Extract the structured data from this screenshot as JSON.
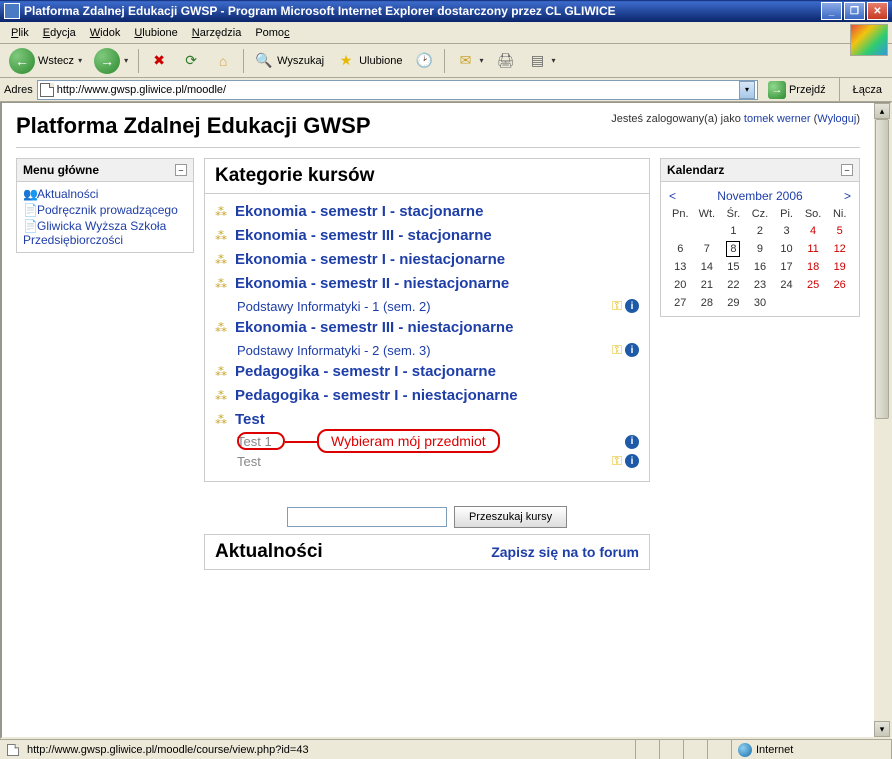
{
  "window": {
    "title": "Platforma Zdalnej Edukacji GWSP - Program Microsoft Internet Explorer dostarczony przez CL GLIWICE"
  },
  "menubar": {
    "file": "Plik",
    "edit": "Edycja",
    "view": "Widok",
    "favorites": "Ulubione",
    "tools": "Narzędzia",
    "help": "Pomoc"
  },
  "toolbar": {
    "back": "Wstecz",
    "search": "Wyszukaj",
    "favorites": "Ulubione"
  },
  "address": {
    "label": "Adres",
    "value": "http://www.gwsp.gliwice.pl/moodle/",
    "go": "Przejdź",
    "links": "Łącza"
  },
  "page": {
    "title": "Platforma Zdalnej Edukacji GWSP",
    "login_prefix": "Jesteś zalogowany(a) jako ",
    "user": "tomek werner",
    "logout": "Wyloguj"
  },
  "menu_block": {
    "title": "Menu główne",
    "items": [
      "Aktualności",
      "Podręcznik prowadzącego",
      "Gliwicka Wyższa Szkoła Przedsiębiorczości"
    ]
  },
  "categories": {
    "title": "Kategorie kursów",
    "list": [
      {
        "type": "cat",
        "label": "Ekonomia - semestr I - stacjonarne"
      },
      {
        "type": "cat",
        "label": "Ekonomia - semestr III - stacjonarne"
      },
      {
        "type": "cat",
        "label": "Ekonomia - semestr I - niestacjonarne"
      },
      {
        "type": "cat",
        "label": "Ekonomia - semestr II - niestacjonarne"
      },
      {
        "type": "course",
        "label": "Podstawy Informatyki - 1 (sem. 2)",
        "key": true,
        "info": true
      },
      {
        "type": "cat",
        "label": "Ekonomia - semestr III - niestacjonarne"
      },
      {
        "type": "course",
        "label": "Podstawy Informatyki - 2 (sem. 3)",
        "key": true,
        "info": true
      },
      {
        "type": "cat",
        "label": "Pedagogika - semestr I - stacjonarne"
      },
      {
        "type": "cat",
        "label": "Pedagogika - semestr I - niestacjonarne"
      },
      {
        "type": "cat",
        "label": "Test"
      },
      {
        "type": "course",
        "label": "Test 1",
        "gray": true,
        "info": true,
        "callout": true
      },
      {
        "type": "course",
        "label": "Test",
        "gray": true,
        "key": true,
        "info": true
      }
    ],
    "callout": "Wybieram mój przedmiot",
    "search_btn": "Przeszukaj kursy"
  },
  "news": {
    "title": "Aktualności",
    "link": "Zapisz się na to forum"
  },
  "calendar": {
    "title": "Kalendarz",
    "month": "November 2006",
    "days": [
      "Pn.",
      "Wt.",
      "Śr.",
      "Cz.",
      "Pi.",
      "So.",
      "Ni."
    ],
    "weeks": [
      [
        "",
        "",
        "1",
        "2",
        "3",
        "4",
        "5"
      ],
      [
        "6",
        "7",
        "8",
        "9",
        "10",
        "11",
        "12"
      ],
      [
        "13",
        "14",
        "15",
        "16",
        "17",
        "18",
        "19"
      ],
      [
        "20",
        "21",
        "22",
        "23",
        "24",
        "25",
        "26"
      ],
      [
        "27",
        "28",
        "29",
        "30",
        "",
        "",
        ""
      ]
    ],
    "today": "8"
  },
  "statusbar": {
    "url": "http://www.gwsp.gliwice.pl/moodle/course/view.php?id=43",
    "zone": "Internet"
  }
}
